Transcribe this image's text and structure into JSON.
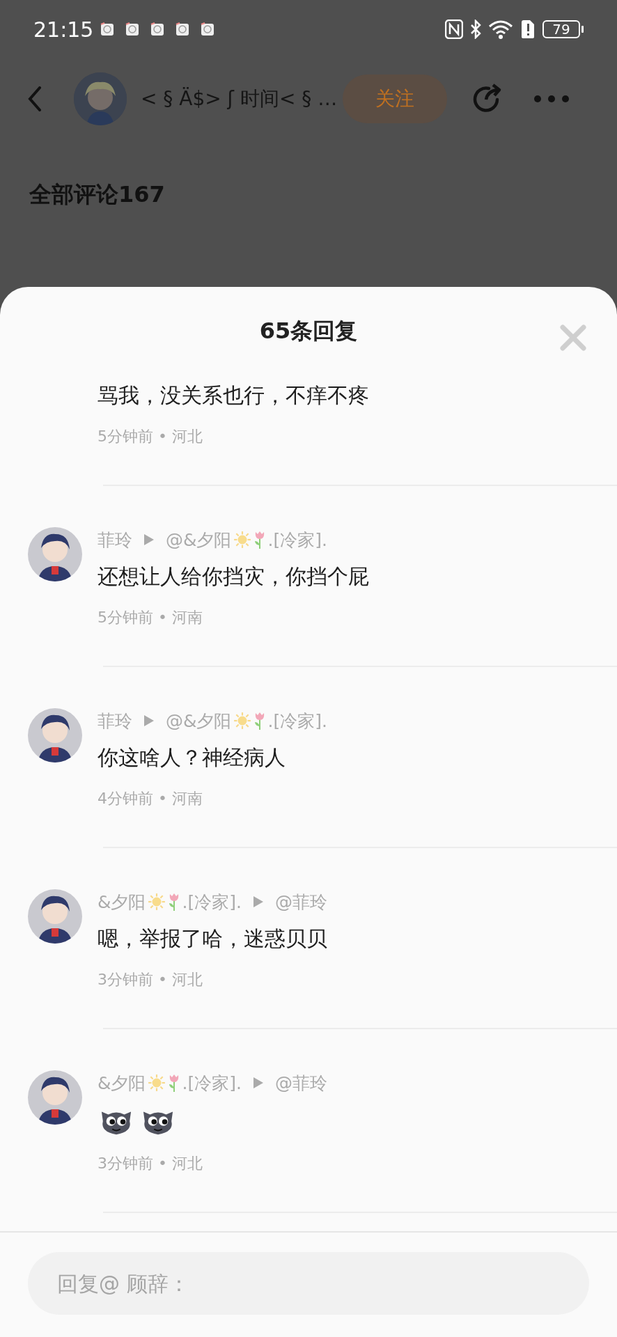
{
  "status_bar": {
    "time": "21:15",
    "notifications": [
      {
        "kind": "app"
      },
      {
        "kind": "app"
      },
      {
        "kind": "app"
      },
      {
        "kind": "app"
      },
      {
        "kind": "app"
      }
    ],
    "battery": "79"
  },
  "header": {
    "title": "< § Ä$> ʃ 时间< § …",
    "follow_button": "关注"
  },
  "comments_heading": "全部评论167",
  "sheet": {
    "title": "65条回复",
    "replies": [
      {
        "text": "骂我，没关系也行，不痒不疼",
        "meta": "5分钟前 • 河北"
      },
      {
        "avatar": {
          "kind": "picture"
        },
        "author": [
          {
            "text": "菲玲"
          }
        ],
        "target": [
          {
            "text": "@&夕阳"
          },
          {
            "kind": "sun"
          },
          {
            "kind": "tulip"
          },
          {
            "text": ".[冷家]."
          }
        ],
        "text": "还想让人给你挡灾，你挡个屁",
        "meta": "5分钟前 • 河南"
      },
      {
        "avatar": {
          "kind": "picture"
        },
        "author": [
          {
            "text": "菲玲"
          }
        ],
        "target": [
          {
            "text": "@&夕阳"
          },
          {
            "kind": "sun"
          },
          {
            "kind": "tulip"
          },
          {
            "text": ".[冷家]."
          }
        ],
        "text": "你这啥人？神经病人",
        "meta": "4分钟前 • 河南"
      },
      {
        "avatar": {
          "kind": "picture"
        },
        "author": [
          {
            "text": "&夕阳"
          },
          {
            "kind": "sun"
          },
          {
            "kind": "tulip"
          },
          {
            "text": ".[冷家]."
          }
        ],
        "target": [
          {
            "text": "@菲玲"
          }
        ],
        "text": "嗯，举报了哈，迷惑贝贝",
        "meta": "3分钟前 • 河北"
      },
      {
        "avatar": {
          "kind": "picture"
        },
        "author": [
          {
            "text": "&夕阳"
          },
          {
            "kind": "sun"
          },
          {
            "kind": "tulip"
          },
          {
            "text": ".[冷家]."
          }
        ],
        "target": [
          {
            "text": "@菲玲"
          }
        ],
        "stickers": [
          {
            "kind": "cat"
          },
          {
            "kind": "cat"
          }
        ],
        "meta": "3分钟前 • 河北"
      }
    ],
    "reply_field": {
      "placeholder": "回复@ 顾辞："
    }
  }
}
